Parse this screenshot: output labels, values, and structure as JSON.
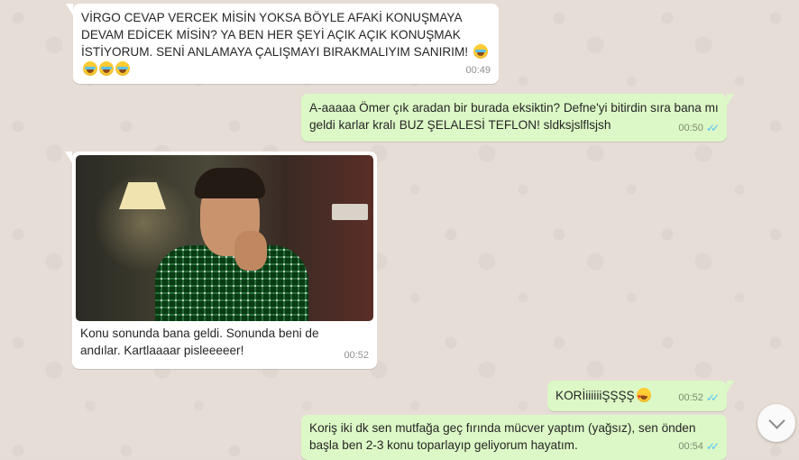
{
  "messages": [
    {
      "direction": "incoming",
      "text": "VİRGO CEVAP VERCEK MİSİN YOKSA BÖYLE AFAKİ KONUŞMAYA DEVAM EDİCEK MİSİN? YA BEN HER ŞEYİ AÇIK AÇIK KONUŞMAK İSTİYORUM. SENİ ANLAMAYA ÇALIŞMAYI BIRAKMALIYIM SANIRIM!",
      "emojis": [
        "face-with-tears-of-joy",
        "face-with-tears-of-joy",
        "face-with-tears-of-joy",
        "face-with-tears-of-joy"
      ],
      "time": "00:49"
    },
    {
      "direction": "outgoing",
      "text": "A-aaaaa Ömer çık aradan bir burada eksiktin? Defne'yi bitirdin sıra bana mı geldi karlar kralı BUZ ŞELALESİ TEFLON! sldksjslflsjsh",
      "time": "00:50",
      "status": "read"
    },
    {
      "direction": "incoming",
      "type": "image",
      "caption": "Konu sonunda bana geldi. Sonunda beni de andılar. Kartlaaaar pisleeeeer!",
      "time": "00:52"
    },
    {
      "direction": "outgoing",
      "text": "KORİiiiiiiŞŞŞŞ",
      "emojis": [
        "smiling-face-with-heart-eyes"
      ],
      "time": "00:52",
      "status": "read"
    },
    {
      "direction": "outgoing",
      "text": "Koriş iki dk sen mutfağa geç fırında mücver yaptım (yağsız), sen önden başla ben 2-3 konu toparlayıp geliyorum hayatım.",
      "time": "00:54",
      "status": "read"
    }
  ],
  "icons": {
    "read_receipt": "double-check-icon",
    "scroll_down": "chevron-down-icon"
  },
  "colors": {
    "incoming_bubble": "#ffffff",
    "outgoing_bubble": "#dcf8c6",
    "read_ticks": "#4fc3f7",
    "wallpaper": "#e5ddd5"
  }
}
